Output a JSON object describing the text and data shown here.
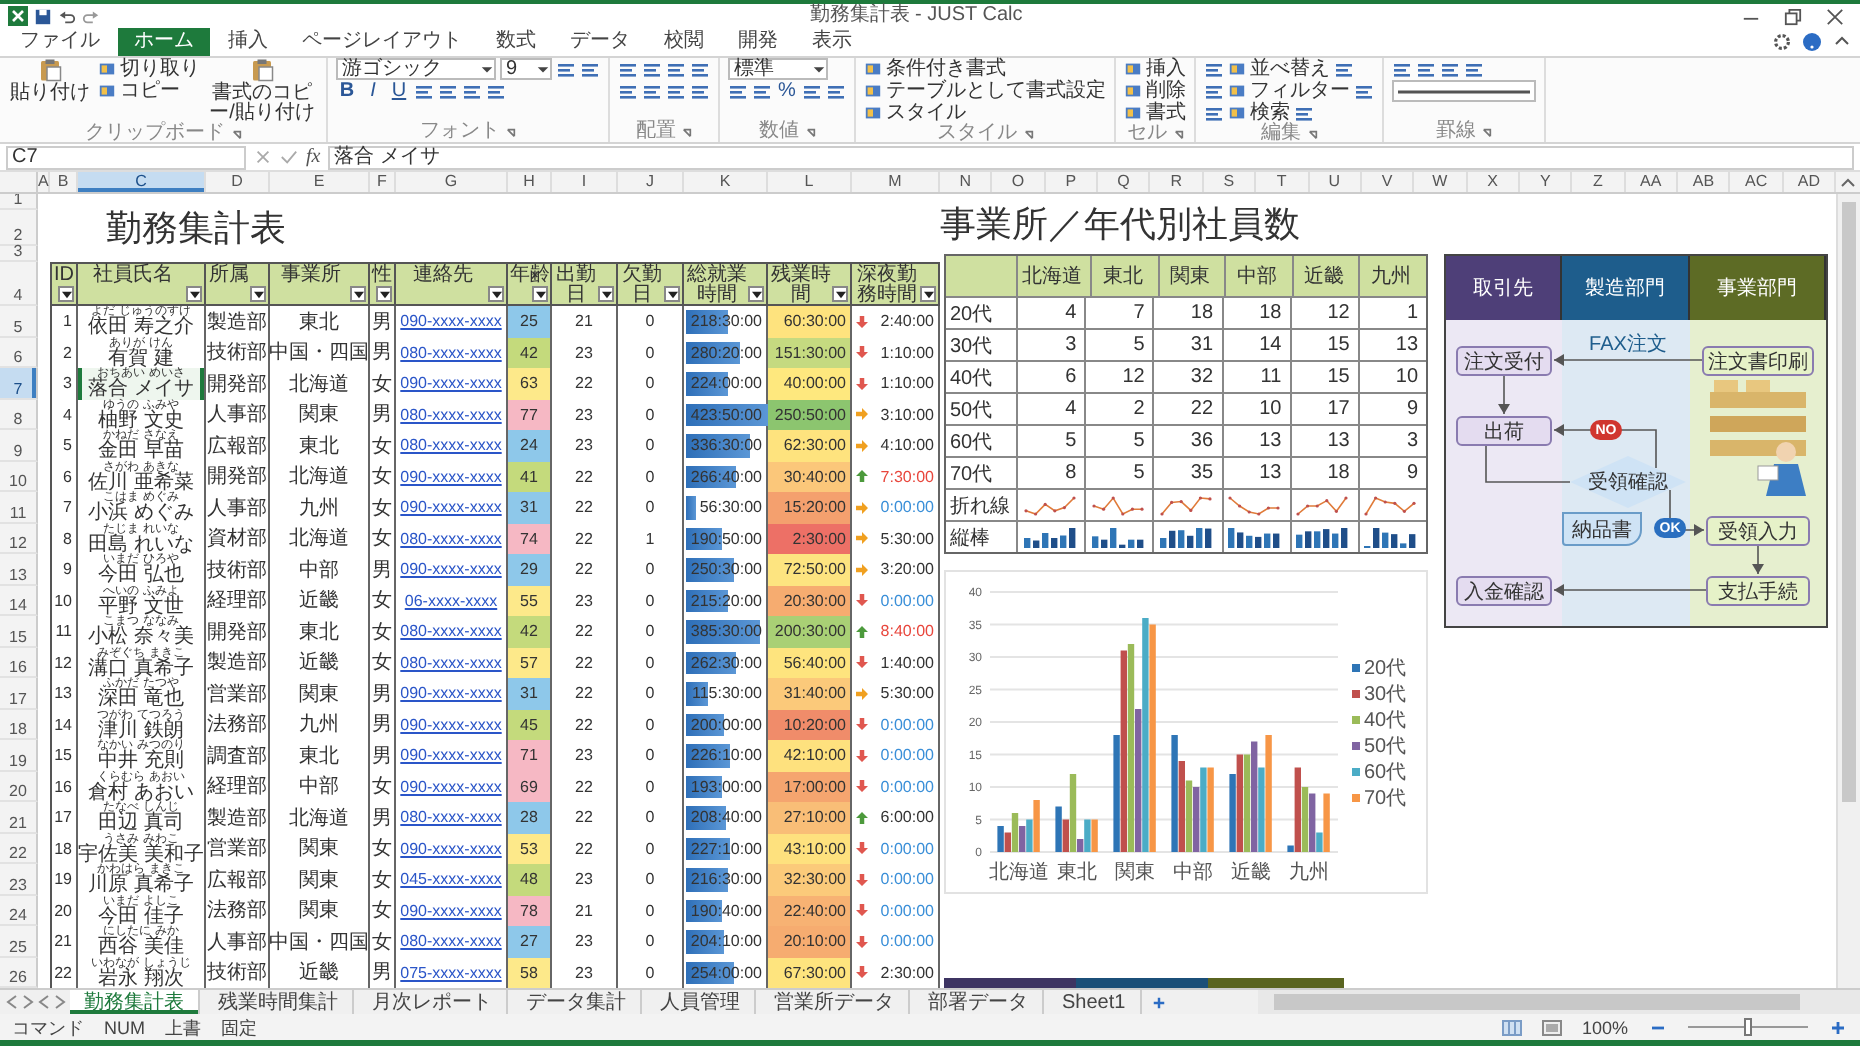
{
  "window": {
    "title": "勤務集計表 - JUST Calc"
  },
  "ribbon_tabs": [
    {
      "label": "ファイル",
      "selected": false
    },
    {
      "label": "ホーム",
      "selected": true
    },
    {
      "label": "挿入",
      "selected": false
    },
    {
      "label": "ページレイアウト",
      "selected": false
    },
    {
      "label": "数式",
      "selected": false
    },
    {
      "label": "データ",
      "selected": false
    },
    {
      "label": "校閲",
      "selected": false
    },
    {
      "label": "開発",
      "selected": false
    },
    {
      "label": "表示",
      "selected": false
    }
  ],
  "ribbon_groups": [
    {
      "label": "クリップボード",
      "parts": [
        {
          "kind": "large",
          "label": "貼り付け"
        },
        {
          "kind": "stack",
          "lines": [
            {
              "items": [
                {
                  "kind": "button",
                  "label": "切り取り"
                }
              ]
            },
            {
              "items": [
                {
                  "kind": "button",
                  "label": "コピー"
                }
              ]
            }
          ]
        },
        {
          "kind": "large",
          "label": "書式のコピー/貼り付け"
        }
      ]
    },
    {
      "label": "フォント",
      "parts": [
        {
          "kind": "stack",
          "lines": [
            {
              "items": [
                {
                  "kind": "select",
                  "value": "游ゴシック"
                },
                {
                  "kind": "select",
                  "value": "9"
                },
                {
                  "kind": "icon"
                },
                {
                  "kind": "icon"
                }
              ]
            },
            {
              "items": [
                {
                  "kind": "letter",
                  "label": "B"
                },
                {
                  "kind": "letter",
                  "label": "I"
                },
                {
                  "kind": "letter",
                  "label": "U"
                },
                {
                  "kind": "icon"
                },
                {
                  "kind": "icon"
                },
                {
                  "kind": "icon"
                },
                {
                  "kind": "icon"
                }
              ]
            }
          ]
        }
      ]
    },
    {
      "label": "配置",
      "parts": [
        {
          "kind": "stack",
          "lines": [
            {
              "items": [
                {
                  "kind": "icon"
                },
                {
                  "kind": "icon"
                },
                {
                  "kind": "icon"
                },
                {
                  "kind": "icon"
                }
              ]
            },
            {
              "items": [
                {
                  "kind": "icon"
                },
                {
                  "kind": "icon"
                },
                {
                  "kind": "icon"
                },
                {
                  "kind": "icon"
                }
              ]
            }
          ]
        }
      ]
    },
    {
      "label": "数値",
      "parts": [
        {
          "kind": "stack",
          "lines": [
            {
              "items": [
                {
                  "kind": "select",
                  "value": "標準"
                }
              ]
            },
            {
              "items": [
                {
                  "kind": "icon"
                },
                {
                  "kind": "icon"
                },
                {
                  "kind": "letter",
                  "label": "%"
                },
                {
                  "kind": "icon"
                },
                {
                  "kind": "icon"
                }
              ]
            }
          ]
        }
      ]
    },
    {
      "label": "スタイル",
      "parts": [
        {
          "kind": "stack",
          "lines": [
            {
              "items": [
                {
                  "kind": "button",
                  "label": "条件付き書式"
                }
              ]
            },
            {
              "items": [
                {
                  "kind": "button",
                  "label": "テーブルとして書式設定"
                }
              ]
            },
            {
              "items": [
                {
                  "kind": "button",
                  "label": "スタイル"
                }
              ]
            }
          ]
        }
      ]
    },
    {
      "label": "セル",
      "parts": [
        {
          "kind": "stack",
          "lines": [
            {
              "items": [
                {
                  "kind": "button",
                  "label": "挿入"
                }
              ]
            },
            {
              "items": [
                {
                  "kind": "button",
                  "label": "削除"
                }
              ]
            },
            {
              "items": [
                {
                  "kind": "button",
                  "label": "書式"
                }
              ]
            }
          ]
        }
      ]
    },
    {
      "label": "編集",
      "parts": [
        {
          "kind": "stack",
          "lines": [
            {
              "items": [
                {
                  "kind": "icon"
                },
                {
                  "kind": "button",
                  "label": "並べ替え"
                },
                {
                  "kind": "icon"
                }
              ]
            },
            {
              "items": [
                {
                  "kind": "icon"
                },
                {
                  "kind": "button",
                  "label": "フィルター"
                },
                {
                  "kind": "icon"
                }
              ]
            },
            {
              "items": [
                {
                  "kind": "icon"
                },
                {
                  "kind": "button",
                  "label": "検索"
                },
                {
                  "kind": "icon"
                }
              ]
            }
          ]
        }
      ]
    },
    {
      "label": "罫線",
      "parts": [
        {
          "kind": "stack",
          "lines": [
            {
              "items": [
                {
                  "kind": "icon"
                },
                {
                  "kind": "icon"
                },
                {
                  "kind": "icon"
                },
                {
                  "kind": "icon"
                }
              ]
            },
            {
              "items": [
                {
                  "kind": "linepicker"
                }
              ]
            }
          ]
        }
      ]
    }
  ],
  "formula_bar": {
    "cell": "C7",
    "function_label": "fx",
    "value": "落合 メイサ"
  },
  "sheet": {
    "columns": [
      {
        "label": "A",
        "selected": false
      },
      {
        "label": "B",
        "selected": false
      },
      {
        "label": "C",
        "selected": true
      },
      {
        "label": "D",
        "selected": false
      },
      {
        "label": "E",
        "selected": false
      },
      {
        "label": "F",
        "selected": false
      },
      {
        "label": "G",
        "selected": false
      },
      {
        "label": "H",
        "selected": false
      },
      {
        "label": "I",
        "selected": false
      },
      {
        "label": "J",
        "selected": false
      },
      {
        "label": "K",
        "selected": false
      },
      {
        "label": "L",
        "selected": false
      },
      {
        "label": "M",
        "selected": false
      },
      {
        "label": "N",
        "selected": false
      },
      {
        "label": "O",
        "selected": false
      },
      {
        "label": "P",
        "selected": false
      },
      {
        "label": "Q",
        "selected": false
      },
      {
        "label": "R",
        "selected": false
      },
      {
        "label": "S",
        "selected": false
      },
      {
        "label": "T",
        "selected": false
      },
      {
        "label": "U",
        "selected": false
      },
      {
        "label": "V",
        "selected": false
      },
      {
        "label": "W",
        "selected": false
      },
      {
        "label": "X",
        "selected": false
      },
      {
        "label": "Y",
        "selected": false
      },
      {
        "label": "Z",
        "selected": false
      },
      {
        "label": "AA",
        "selected": false
      },
      {
        "label": "AB",
        "selected": false
      },
      {
        "label": "AC",
        "selected": false
      },
      {
        "label": "AD",
        "selected": false
      }
    ],
    "row_numbers": [
      {
        "label": "1",
        "selected": false
      },
      {
        "label": "2",
        "selected": false
      },
      {
        "label": "3",
        "selected": false
      },
      {
        "label": "4",
        "selected": false
      },
      {
        "label": "5",
        "selected": false
      },
      {
        "label": "6",
        "selected": false
      },
      {
        "label": "7",
        "selected": true
      },
      {
        "label": "8",
        "selected": false
      },
      {
        "label": "9",
        "selected": false
      },
      {
        "label": "10",
        "selected": false
      },
      {
        "label": "11",
        "selected": false
      },
      {
        "label": "12",
        "selected": false
      },
      {
        "label": "13",
        "selected": false
      },
      {
        "label": "14",
        "selected": false
      },
      {
        "label": "15",
        "selected": false
      },
      {
        "label": "16",
        "selected": false
      },
      {
        "label": "17",
        "selected": false
      },
      {
        "label": "18",
        "selected": false
      },
      {
        "label": "19",
        "selected": false
      },
      {
        "label": "20",
        "selected": false
      },
      {
        "label": "21",
        "selected": false
      },
      {
        "label": "22",
        "selected": false
      },
      {
        "label": "23",
        "selected": false
      },
      {
        "label": "24",
        "selected": false
      },
      {
        "label": "25",
        "selected": false
      },
      {
        "label": "26",
        "selected": false
      }
    ]
  },
  "attendance": {
    "title": "勤務集計表",
    "headers": [
      "ID",
      "社員氏名",
      "所属",
      "事業所",
      "性",
      "連絡先",
      "年齢",
      "出勤日",
      "欠勤日",
      "総就業時間",
      "残業時間",
      "深夜勤務時間"
    ],
    "rows": [
      {
        "id": "1",
        "reading": "よだ じゅうのすけ",
        "name": "依田 寿之介",
        "dept": "製造部",
        "office": "東北",
        "gender": "男",
        "phone": "090-xxxx-xxxx",
        "age": {
          "value": "25",
          "color": "#8ec8ea"
        },
        "days": "21",
        "absent": "0",
        "total": "218:30:00",
        "level": 0.51,
        "overtime": {
          "value": "60:30:00",
          "color": "#fee37e"
        },
        "late": {
          "value": "2:40:00",
          "color": "#333333",
          "icon": {
            "kind": "down",
            "color": "#e0574f"
          }
        },
        "selected": false
      },
      {
        "id": "2",
        "reading": "ありが けん",
        "name": "有賀 建",
        "dept": "技術部",
        "office": "中国・四国",
        "gender": "男",
        "phone": "080-xxxx-xxxx",
        "age": {
          "value": "42",
          "color": "#c4da7c"
        },
        "days": "23",
        "absent": "0",
        "total": "280:20:00",
        "level": 0.65,
        "overtime": {
          "value": "151:30:00",
          "color": "#c5da80"
        },
        "late": {
          "value": "1:10:00",
          "color": "#333333",
          "icon": {
            "kind": "down",
            "color": "#e0574f"
          }
        },
        "selected": false
      },
      {
        "id": "3",
        "reading": "おちあい めいさ",
        "name": "落合 メイサ",
        "dept": "開発部",
        "office": "北海道",
        "gender": "女",
        "phone": "090-xxxx-xxxx",
        "age": {
          "value": "63",
          "color": "#fde98a"
        },
        "days": "22",
        "absent": "0",
        "total": "224:00:00",
        "level": 0.52,
        "overtime": {
          "value": "40:00:00",
          "color": "#fee87e"
        },
        "late": {
          "value": "1:10:00",
          "color": "#333333",
          "icon": {
            "kind": "down",
            "color": "#e0574f"
          }
        },
        "selected": true
      },
      {
        "id": "4",
        "reading": "ゆうの ふみや",
        "name": "柚野 文史",
        "dept": "人事部",
        "office": "関東",
        "gender": "男",
        "phone": "080-xxxx-xxxx",
        "age": {
          "value": "77",
          "color": "#f6b8c4"
        },
        "days": "23",
        "absent": "0",
        "total": "423:50:00",
        "level": 0.99,
        "overtime": {
          "value": "250:50:00",
          "color": "#8cc56f"
        },
        "late": {
          "value": "3:10:00",
          "color": "#333333",
          "icon": {
            "kind": "right",
            "color": "#f0a020"
          }
        },
        "selected": false
      },
      {
        "id": "5",
        "reading": "かねだ さなえ",
        "name": "金田 早苗",
        "dept": "広報部",
        "office": "東北",
        "gender": "女",
        "phone": "080-xxxx-xxxx",
        "age": {
          "value": "24",
          "color": "#8ec8ea"
        },
        "days": "23",
        "absent": "0",
        "total": "336:30:00",
        "level": 0.78,
        "overtime": {
          "value": "62:30:00",
          "color": "#fee37e"
        },
        "late": {
          "value": "4:10:00",
          "color": "#333333",
          "icon": {
            "kind": "right",
            "color": "#f0a020"
          }
        },
        "selected": false
      },
      {
        "id": "6",
        "reading": "さがわ あきな",
        "name": "佐川 亜希菜",
        "dept": "開発部",
        "office": "北海道",
        "gender": "女",
        "phone": "090-xxxx-xxxx",
        "age": {
          "value": "41",
          "color": "#c4da7c"
        },
        "days": "22",
        "absent": "0",
        "total": "266:40:00",
        "level": 0.62,
        "overtime": {
          "value": "30:40:00",
          "color": "#fbc77a"
        },
        "late": {
          "value": "7:30:00",
          "color": "#e8463c",
          "icon": {
            "kind": "up",
            "color": "#4c9a3c"
          }
        },
        "selected": false
      },
      {
        "id": "7",
        "reading": "こはま めぐみ",
        "name": "小浜 めぐみ",
        "dept": "人事部",
        "office": "九州",
        "gender": "女",
        "phone": "090-xxxx-xxxx",
        "age": {
          "value": "31",
          "color": "#8ec8ea"
        },
        "days": "22",
        "absent": "0",
        "total": "56:30:00",
        "level": 0.13,
        "overtime": {
          "value": "15:20:00",
          "color": "#f4a06e"
        },
        "late": {
          "value": "0:00:00",
          "color": "#3a8fd8",
          "icon": {
            "kind": "right",
            "color": "#f0a020"
          }
        },
        "selected": false
      },
      {
        "id": "8",
        "reading": "たじま れいな",
        "name": "田島 れいな",
        "dept": "資材部",
        "office": "北海道",
        "gender": "女",
        "phone": "080-xxxx-xxxx",
        "age": {
          "value": "74",
          "color": "#f6b8c4"
        },
        "days": "22",
        "absent": "1",
        "total": "190:50:00",
        "level": 0.44,
        "overtime": {
          "value": "2:30:00",
          "color": "#ed7066"
        },
        "late": {
          "value": "5:30:00",
          "color": "#333333",
          "icon": {
            "kind": "right",
            "color": "#f0a020"
          }
        },
        "selected": false
      },
      {
        "id": "9",
        "reading": "いまだ ひろや",
        "name": "今田 弘也",
        "dept": "技術部",
        "office": "中部",
        "gender": "男",
        "phone": "090-xxxx-xxxx",
        "age": {
          "value": "29",
          "color": "#8ec8ea"
        },
        "days": "22",
        "absent": "0",
        "total": "250:30:00",
        "level": 0.58,
        "overtime": {
          "value": "72:50:00",
          "color": "#fde480"
        },
        "late": {
          "value": "3:20:00",
          "color": "#333333",
          "icon": {
            "kind": "right",
            "color": "#f0a020"
          }
        },
        "selected": false
      },
      {
        "id": "10",
        "reading": "へいの ふみよ",
        "name": "平野 文世",
        "dept": "経理部",
        "office": "近畿",
        "gender": "女",
        "phone": "06-xxxx-xxxx",
        "age": {
          "value": "55",
          "color": "#fde98a"
        },
        "days": "23",
        "absent": "0",
        "total": "215:20:00",
        "level": 0.5,
        "overtime": {
          "value": "20:30:00",
          "color": "#f6ac70"
        },
        "late": {
          "value": "0:00:00",
          "color": "#3a8fd8",
          "icon": {
            "kind": "down",
            "color": "#e0574f"
          }
        },
        "selected": false
      },
      {
        "id": "11",
        "reading": "こまつ ななみ",
        "name": "小松 奈々美",
        "dept": "開発部",
        "office": "東北",
        "gender": "女",
        "phone": "080-xxxx-xxxx",
        "age": {
          "value": "42",
          "color": "#c4da7c"
        },
        "days": "22",
        "absent": "0",
        "total": "385:30:00",
        "level": 0.9,
        "overtime": {
          "value": "200:30:00",
          "color": "#a9d075"
        },
        "late": {
          "value": "8:40:00",
          "color": "#e8463c",
          "icon": {
            "kind": "up",
            "color": "#4c9a3c"
          }
        },
        "selected": false
      },
      {
        "id": "12",
        "reading": "みぞぐち まきこ",
        "name": "溝口 真希子",
        "dept": "製造部",
        "office": "近畿",
        "gender": "女",
        "phone": "080-xxxx-xxxx",
        "age": {
          "value": "57",
          "color": "#fde98a"
        },
        "days": "22",
        "absent": "0",
        "total": "262:30:00",
        "level": 0.61,
        "overtime": {
          "value": "56:40:00",
          "color": "#fee47e"
        },
        "late": {
          "value": "1:40:00",
          "color": "#333333",
          "icon": {
            "kind": "down",
            "color": "#e0574f"
          }
        },
        "selected": false
      },
      {
        "id": "13",
        "reading": "ふかだ たつや",
        "name": "深田 竜也",
        "dept": "営業部",
        "office": "関東",
        "gender": "男",
        "phone": "090-xxxx-xxxx",
        "age": {
          "value": "31",
          "color": "#8ec8ea"
        },
        "days": "22",
        "absent": "0",
        "total": "115:30:00",
        "level": 0.27,
        "overtime": {
          "value": "31:40:00",
          "color": "#fbc97a"
        },
        "late": {
          "value": "5:30:00",
          "color": "#333333",
          "icon": {
            "kind": "right",
            "color": "#f0a020"
          }
        },
        "selected": false
      },
      {
        "id": "14",
        "reading": "つがわ てつろう",
        "name": "津川 鉄朗",
        "dept": "法務部",
        "office": "九州",
        "gender": "男",
        "phone": "090-xxxx-xxxx",
        "age": {
          "value": "45",
          "color": "#c4da7c"
        },
        "days": "22",
        "absent": "0",
        "total": "200:00:00",
        "level": 0.47,
        "overtime": {
          "value": "10:20:00",
          "color": "#f08c6a"
        },
        "late": {
          "value": "0:00:00",
          "color": "#3a8fd8",
          "icon": {
            "kind": "down",
            "color": "#e0574f"
          }
        },
        "selected": false
      },
      {
        "id": "15",
        "reading": "なかい みつのり",
        "name": "中井 充則",
        "dept": "調査部",
        "office": "東北",
        "gender": "男",
        "phone": "090-xxxx-xxxx",
        "age": {
          "value": "71",
          "color": "#f6b8c4"
        },
        "days": "23",
        "absent": "0",
        "total": "226:10:00",
        "level": 0.53,
        "overtime": {
          "value": "42:10:00",
          "color": "#fee17e"
        },
        "late": {
          "value": "0:00:00",
          "color": "#3a8fd8",
          "icon": {
            "kind": "down",
            "color": "#e0574f"
          }
        },
        "selected": false
      },
      {
        "id": "16",
        "reading": "くらむら あおい",
        "name": "倉村 あおい",
        "dept": "経理部",
        "office": "中部",
        "gender": "女",
        "phone": "090-xxxx-xxxx",
        "age": {
          "value": "69",
          "color": "#f6b8c4"
        },
        "days": "22",
        "absent": "0",
        "total": "193:00:00",
        "level": 0.45,
        "overtime": {
          "value": "17:00:00",
          "color": "#f5a56f"
        },
        "late": {
          "value": "0:00:00",
          "color": "#3a8fd8",
          "icon": {
            "kind": "down",
            "color": "#e0574f"
          }
        },
        "selected": false
      },
      {
        "id": "17",
        "reading": "たなべ しんじ",
        "name": "田辺 真司",
        "dept": "製造部",
        "office": "北海道",
        "gender": "男",
        "phone": "080-xxxx-xxxx",
        "age": {
          "value": "28",
          "color": "#8ec8ea"
        },
        "days": "22",
        "absent": "0",
        "total": "208:40:00",
        "level": 0.49,
        "overtime": {
          "value": "27:10:00",
          "color": "#f9be77"
        },
        "late": {
          "value": "6:00:00",
          "color": "#333333",
          "icon": {
            "kind": "up",
            "color": "#4c9a3c"
          }
        },
        "selected": false
      },
      {
        "id": "18",
        "reading": "うさみ みわこ",
        "name": "宇佐美 美和子",
        "dept": "営業部",
        "office": "関東",
        "gender": "女",
        "phone": "090-xxxx-xxxx",
        "age": {
          "value": "53",
          "color": "#fde98a"
        },
        "days": "22",
        "absent": "0",
        "total": "227:10:00",
        "level": 0.53,
        "overtime": {
          "value": "43:10:00",
          "color": "#fee17e"
        },
        "late": {
          "value": "0:00:00",
          "color": "#3a8fd8",
          "icon": {
            "kind": "down",
            "color": "#e0574f"
          }
        },
        "selected": false
      },
      {
        "id": "19",
        "reading": "かわはら まきこ",
        "name": "川原 真希子",
        "dept": "広報部",
        "office": "関東",
        "gender": "女",
        "phone": "045-xxxx-xxxx",
        "age": {
          "value": "48",
          "color": "#c4da7c"
        },
        "days": "23",
        "absent": "0",
        "total": "216:30:00",
        "level": 0.5,
        "overtime": {
          "value": "32:30:00",
          "color": "#fbca7a"
        },
        "late": {
          "value": "0:00:00",
          "color": "#3a8fd8",
          "icon": {
            "kind": "down",
            "color": "#e0574f"
          }
        },
        "selected": false
      },
      {
        "id": "20",
        "reading": "いまだ よしこ",
        "name": "今田 佳子",
        "dept": "法務部",
        "office": "関東",
        "gender": "女",
        "phone": "090-xxxx-xxxx",
        "age": {
          "value": "78",
          "color": "#f6b8c4"
        },
        "days": "21",
        "absent": "0",
        "total": "190:40:00",
        "level": 0.44,
        "overtime": {
          "value": "22:40:00",
          "color": "#f7b273"
        },
        "late": {
          "value": "0:00:00",
          "color": "#3a8fd8",
          "icon": {
            "kind": "down",
            "color": "#e0574f"
          }
        },
        "selected": false
      },
      {
        "id": "21",
        "reading": "にしたに みか",
        "name": "西谷 美佳",
        "dept": "人事部",
        "office": "中国・四国",
        "gender": "女",
        "phone": "080-xxxx-xxxx",
        "age": {
          "value": "27",
          "color": "#8ec8ea"
        },
        "days": "23",
        "absent": "0",
        "total": "204:10:00",
        "level": 0.47,
        "overtime": {
          "value": "20:10:00",
          "color": "#f6ac70"
        },
        "late": {
          "value": "0:00:00",
          "color": "#3a8fd8",
          "icon": {
            "kind": "down",
            "color": "#e0574f"
          }
        },
        "selected": false
      },
      {
        "id": "22",
        "reading": "いわなが しょうじ",
        "name": "岩永 翔次",
        "dept": "技術部",
        "office": "近畿",
        "gender": "男",
        "phone": "075-xxxx-xxxx",
        "age": {
          "value": "58",
          "color": "#fde98a"
        },
        "days": "23",
        "absent": "0",
        "total": "254:00:00",
        "level": 0.59,
        "overtime": {
          "value": "67:30:00",
          "color": "#fee47e"
        },
        "late": {
          "value": "2:30:00",
          "color": "#333333",
          "icon": {
            "kind": "down",
            "color": "#e0574f"
          }
        },
        "selected": false
      }
    ]
  },
  "region_table": {
    "title": "事業所／年代別社員数",
    "columns": [
      "北海道",
      "東北",
      "関東",
      "中部",
      "近畿",
      "九州"
    ],
    "rows": [
      {
        "label": "20代",
        "values": [
          "4",
          "7",
          "18",
          "18",
          "12",
          "1"
        ]
      },
      {
        "label": "30代",
        "values": [
          "3",
          "5",
          "31",
          "14",
          "15",
          "13"
        ]
      },
      {
        "label": "40代",
        "values": [
          "6",
          "12",
          "32",
          "11",
          "15",
          "10"
        ]
      },
      {
        "label": "50代",
        "values": [
          "4",
          "2",
          "22",
          "10",
          "17",
          "9"
        ]
      },
      {
        "label": "60代",
        "values": [
          "5",
          "5",
          "36",
          "13",
          "13",
          "3"
        ]
      },
      {
        "label": "70代",
        "values": [
          "8",
          "5",
          "35",
          "13",
          "18",
          "9"
        ]
      }
    ],
    "sparklines": [
      {
        "label": "折れ線",
        "kind": "line"
      },
      {
        "label": "縦棒",
        "kind": "column"
      }
    ]
  },
  "region_chart": {
    "chart_data": {
      "type": "bar",
      "categories": [
        "北海道",
        "東北",
        "関東",
        "中部",
        "近畿",
        "九州"
      ],
      "ylim": [
        0,
        40
      ],
      "yticks": [
        0,
        5,
        10,
        15,
        20,
        25,
        30,
        35,
        40
      ],
      "grid": true,
      "legend": true,
      "series": [
        {
          "name": "20代",
          "color": "#2e75b6",
          "values": [
            4,
            7,
            18,
            18,
            12,
            1
          ]
        },
        {
          "name": "30代",
          "color": "#c0504d",
          "values": [
            3,
            5,
            31,
            14,
            15,
            13
          ]
        },
        {
          "name": "40代",
          "color": "#9bbb59",
          "values": [
            6,
            12,
            32,
            11,
            15,
            10
          ]
        },
        {
          "name": "50代",
          "color": "#8064a2",
          "values": [
            4,
            2,
            22,
            10,
            17,
            9
          ]
        },
        {
          "name": "60代",
          "color": "#4bacc6",
          "values": [
            5,
            5,
            36,
            13,
            13,
            3
          ]
        },
        {
          "name": "70代",
          "color": "#f79646",
          "values": [
            8,
            5,
            35,
            13,
            18,
            9
          ]
        }
      ]
    }
  },
  "flow": {
    "lanes": [
      {
        "label": "取引先",
        "color": "#4e3f78"
      },
      {
        "label": "製造部門",
        "color": "#1e5d8c"
      },
      {
        "label": "事業部門",
        "color": "#5d6b25"
      }
    ],
    "nodes": [
      {
        "label": "注文受付",
        "kind": "box",
        "color": "#e4dcf0"
      },
      {
        "label": "出荷",
        "kind": "box",
        "color": "#e4dcf0"
      },
      {
        "label": "入金確認",
        "kind": "box",
        "color": "#e4dcf0"
      },
      {
        "label": "FAX注文",
        "kind": "note",
        "color": "#1e5d8c"
      },
      {
        "label": "受領確認",
        "kind": "decision",
        "color": "#cfe3f5"
      },
      {
        "label": "納品書",
        "kind": "document",
        "color": "#cfe3f5"
      },
      {
        "label": "注文書印刷",
        "kind": "box",
        "color": "#e6f2c8"
      },
      {
        "label": "受領入力",
        "kind": "box",
        "color": "#e6f2c8"
      },
      {
        "label": "支払手続",
        "kind": "box",
        "color": "#e6f2c8"
      }
    ],
    "badges": [
      {
        "label": "NO",
        "color": "#d0362f"
      },
      {
        "label": "OK",
        "color": "#2a6fc0"
      }
    ]
  },
  "sheet_tabs": [
    {
      "label": "勤務集計表",
      "selected": true
    },
    {
      "label": "残業時間集計",
      "selected": false
    },
    {
      "label": "月次レポート",
      "selected": false
    },
    {
      "label": "データ集計",
      "selected": false
    },
    {
      "label": "人員管理",
      "selected": false
    },
    {
      "label": "営業所データ",
      "selected": false
    },
    {
      "label": "部署データ",
      "selected": false
    },
    {
      "label": "Sheet1",
      "selected": false
    }
  ],
  "status_bar": {
    "mode": "コマンド",
    "indicators": [
      "NUM",
      "上書",
      "固定"
    ],
    "zoom": "100%",
    "zoom_level": {
      "level": 0.5
    }
  }
}
